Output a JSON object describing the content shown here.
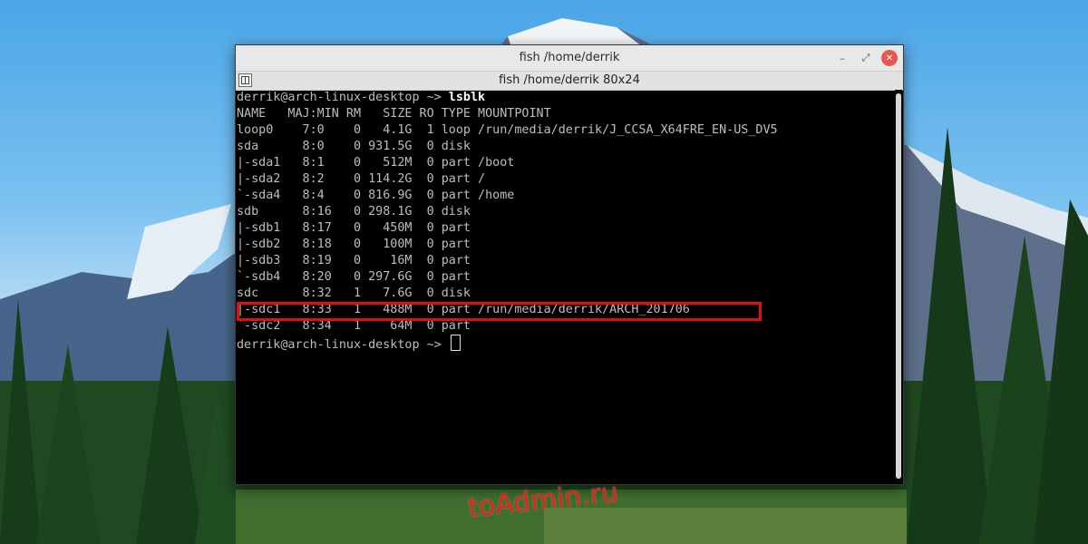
{
  "window": {
    "title": "fish  /home/derrik",
    "tab_title": "fish  /home/derrik 80x24",
    "minimize_symbol": "–",
    "restore_symbol": "⤢",
    "close_symbol": "✕"
  },
  "terminal": {
    "lines": [
      {
        "prompt": "derrik@arch-linux-desktop ~> ",
        "command": "lsblk"
      },
      {
        "text": "NAME   MAJ:MIN RM   SIZE RO TYPE MOUNTPOINT"
      },
      {
        "text": "loop0    7:0    0   4.1G  1 loop /run/media/derrik/J_CCSA_X64FRE_EN-US_DV5"
      },
      {
        "text": "sda      8:0    0 931.5G  0 disk"
      },
      {
        "text": "|-sda1   8:1    0   512M  0 part /boot"
      },
      {
        "text": "|-sda2   8:2    0 114.2G  0 part /"
      },
      {
        "text": "`-sda4   8:4    0 816.9G  0 part /home"
      },
      {
        "text": "sdb      8:16   0 298.1G  0 disk"
      },
      {
        "text": "|-sdb1   8:17   0   450M  0 part"
      },
      {
        "text": "|-sdb2   8:18   0   100M  0 part"
      },
      {
        "text": "|-sdb3   8:19   0    16M  0 part"
      },
      {
        "text": "`-sdb4   8:20   0 297.6G  0 part"
      },
      {
        "text": "sdc      8:32   1   7.6G  0 disk"
      },
      {
        "text": "|-sdc1   8:33   1   488M  0 part /run/media/derrik/ARCH_201706"
      },
      {
        "text": "`-sdc2   8:34   1    64M  0 part"
      },
      {
        "prompt": "derrik@arch-linux-desktop ~> ",
        "command": ""
      }
    ]
  },
  "watermark": "toAdmin.ru",
  "colors": {
    "highlight": "#e10f0f",
    "terminal_bg": "#000000",
    "terminal_fg": "#bdbdbd",
    "watermark": "#e2231a"
  }
}
